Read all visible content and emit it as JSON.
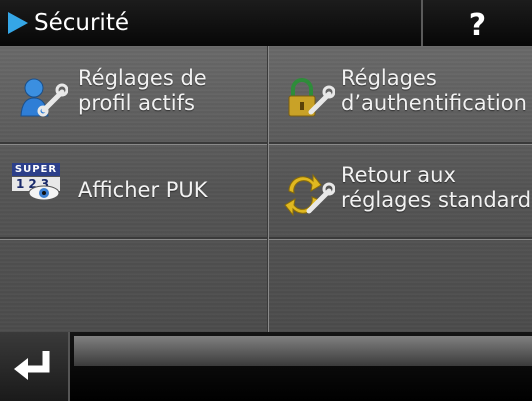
{
  "header": {
    "title": "Sécurité",
    "help_label": "?"
  },
  "menu": {
    "items": [
      {
        "label_line1": "Réglages de",
        "label_line2": "profil actifs",
        "icon": "user-wrench-icon"
      },
      {
        "label_line1": "Réglages",
        "label_line2": "d’authentification",
        "icon": "padlock-wrench-icon"
      },
      {
        "label_line1": "Afficher PUK",
        "icon": "super-123-eye-icon",
        "icon_text": "SUPER",
        "icon_digits": "123"
      },
      {
        "label_line1": "Retour aux",
        "label_line2": "réglages standard",
        "icon": "arrows-wrench-icon"
      }
    ]
  },
  "colors": {
    "accent": "#35a6e6",
    "background": "#5a5a5a",
    "header": "#000000"
  }
}
